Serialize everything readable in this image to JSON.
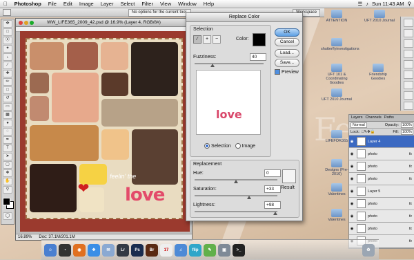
{
  "menubar": {
    "app": "Photoshop",
    "items": [
      "File",
      "Edit",
      "Image",
      "Layer",
      "Select",
      "Filter",
      "View",
      "Window",
      "Help"
    ],
    "clock": "Sun 11:43 AM"
  },
  "options_bar": {
    "tip": "No options for the current tool.",
    "workspace": "Workspace"
  },
  "document": {
    "title": "WW_LIFE365_2009_42.psd @ 16.9% (Layer 4, RGB/8#)",
    "zoom": "16.89%",
    "doc_size": "Doc: 37.1M/201.1M",
    "canvas_text": "love",
    "canvas_script": "feelin' the"
  },
  "dialog": {
    "title": "Replace Color",
    "selection_label": "Selection",
    "color_label": "Color:",
    "fuzziness_label": "Fuzziness:",
    "fuzziness_value": "40",
    "radio_selection": "Selection",
    "radio_image": "Image",
    "preview_text": "love",
    "replacement_label": "Replacement",
    "hue_label": "Hue:",
    "hue_value": "0",
    "saturation_label": "Saturation:",
    "saturation_value": "+33",
    "lightness_label": "Lightness:",
    "lightness_value": "+98",
    "result_label": "Result",
    "buttons": {
      "ok": "OK",
      "cancel": "Cancel",
      "load": "Load...",
      "save": "Save..."
    },
    "preview_check_label": "Preview",
    "colors": {
      "selected": "#000000",
      "result": "#f4f4f4"
    }
  },
  "layers": {
    "tabs": [
      "Layers",
      "Channels",
      "Paths"
    ],
    "mode": "Normal",
    "opacity_label": "Opacity:",
    "opacity": "100%",
    "lock_label": "Lock:",
    "fill_label": "Fill:",
    "fill": "100%",
    "rows": [
      {
        "name": "Layer 4",
        "fx": ""
      },
      {
        "name": "photo",
        "fx": "fx"
      },
      {
        "name": "photo",
        "fx": "fx"
      },
      {
        "name": "photo",
        "fx": "fx"
      },
      {
        "name": "Layer 5",
        "fx": ""
      },
      {
        "name": "photo",
        "fx": "fx"
      },
      {
        "name": "photo",
        "fx": "fx"
      },
      {
        "name": "photo",
        "fx": "fx"
      },
      {
        "name": "photo",
        "fx": "fx"
      }
    ]
  },
  "desktop_icons": [
    {
      "label": "ATTENTION"
    },
    {
      "label": "shutterflyinvestigations"
    },
    {
      "label": "UFT 101 & Coordinating Goodies"
    },
    {
      "label": "Friendship Goodies"
    },
    {
      "label": "UFT 2010 Journal"
    },
    {
      "label": "UFT 2010 Journal"
    },
    {
      "label": "LIFEFOR365"
    },
    {
      "label": "Designs (Pre-2010)"
    },
    {
      "label": "Valentines"
    },
    {
      "label": "Valentines"
    }
  ],
  "dock": [
    "Finder",
    "Dashboard",
    "Firefox",
    "Safari",
    "Mail",
    "Lightroom",
    "Photoshop",
    "Bridge",
    "iCal",
    "iTunes",
    "Flip",
    "iChat",
    "Preview",
    "Terminal",
    "Trash"
  ]
}
